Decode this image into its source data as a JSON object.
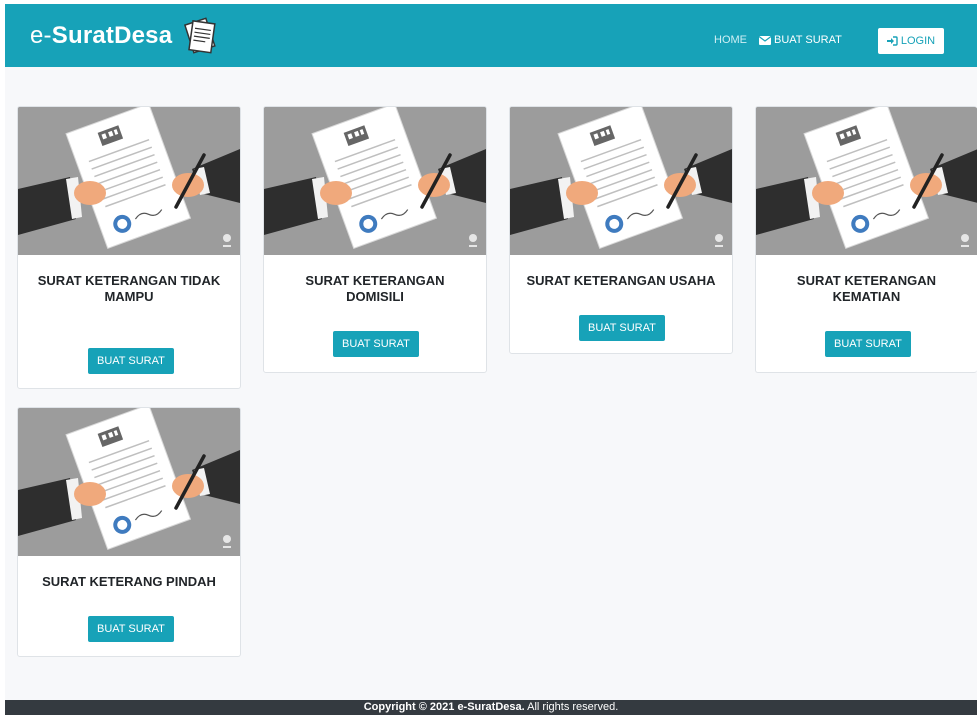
{
  "brand": {
    "prefix": "e-",
    "name": "SuratDesa"
  },
  "nav": {
    "home": "HOME",
    "buat_surat": "BUAT SURAT",
    "login": "LOGIN"
  },
  "cards": [
    {
      "title": "SURAT KETERANGAN TIDAK MAMPU",
      "button": "BUAT SURAT"
    },
    {
      "title": "SURAT KETERANGAN DOMISILI",
      "button": "BUAT SURAT"
    },
    {
      "title": "SURAT KETERANGAN USAHA",
      "button": "BUAT SURAT"
    },
    {
      "title": "SURAT KETERANGAN KEMATIAN",
      "button": "BUAT SURAT"
    },
    {
      "title": "SURAT KETERANG PINDAH",
      "button": "BUAT SURAT"
    }
  ],
  "footer": {
    "copyright": "Copyright © 2021",
    "brand": "e-SuratDesa.",
    "rights": "All rights reserved."
  },
  "colors": {
    "primary": "#17a2b8",
    "footer": "#343a40",
    "background": "#f7f8fa"
  }
}
